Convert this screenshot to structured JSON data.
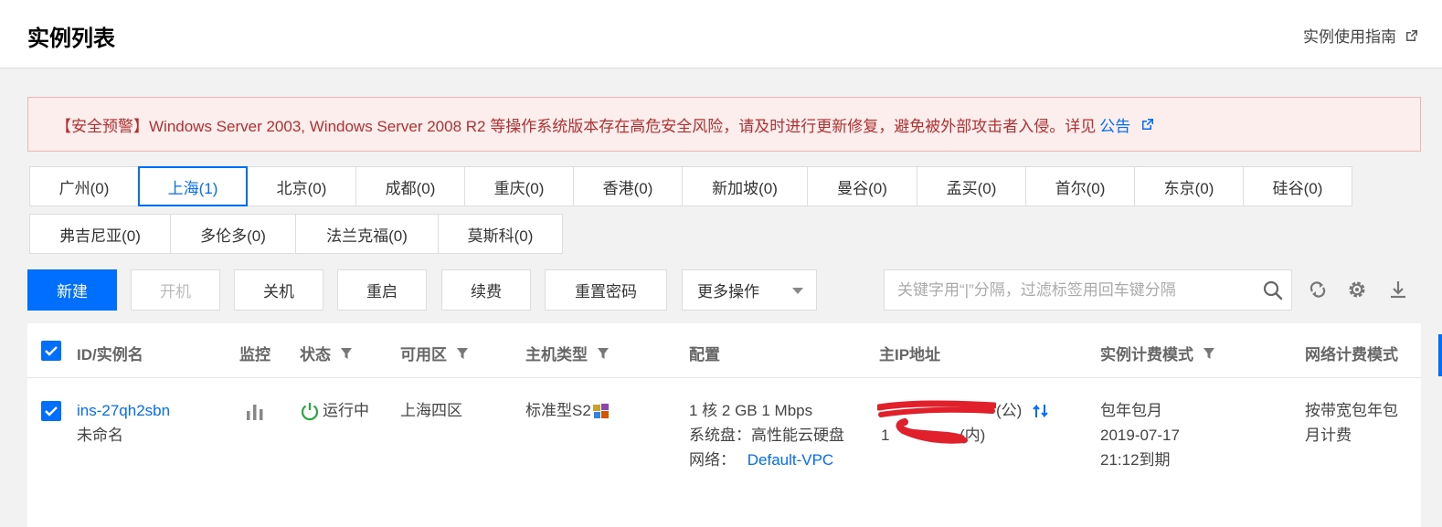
{
  "header": {
    "title": "实例列表",
    "guide_link": "实例使用指南"
  },
  "alert": {
    "text": "【安全预警】Windows Server 2003, Windows Server 2008 R2 等操作系统版本存在高危安全风险，请及时进行更新修复，避免被外部攻击者入侵。详见",
    "link": "公告"
  },
  "regions": [
    {
      "label": "广州(0)"
    },
    {
      "label": "上海(1)",
      "active": true
    },
    {
      "label": "北京(0)"
    },
    {
      "label": "成都(0)"
    },
    {
      "label": "重庆(0)"
    },
    {
      "label": "香港(0)"
    },
    {
      "label": "新加坡(0)"
    },
    {
      "label": "曼谷(0)"
    },
    {
      "label": "孟买(0)"
    },
    {
      "label": "首尔(0)"
    },
    {
      "label": "东京(0)"
    },
    {
      "label": "硅谷(0)"
    },
    {
      "label": "弗吉尼亚(0)"
    },
    {
      "label": "多伦多(0)"
    },
    {
      "label": "法兰克福(0)"
    },
    {
      "label": "莫斯科(0)"
    }
  ],
  "toolbar": {
    "new": "新建",
    "start": "开机",
    "stop": "关机",
    "restart": "重启",
    "renew": "续费",
    "reset_password": "重置密码",
    "more": "更多操作",
    "search_placeholder": "关键字用“|”分隔，过滤标签用回车键分隔"
  },
  "table": {
    "headers": {
      "id": "ID/实例名",
      "monitor": "监控",
      "status": "状态",
      "zone": "可用区",
      "type": "主机类型",
      "config": "配置",
      "ip": "主IP地址",
      "billing": "实例计费模式",
      "network_billing": "网络计费模式"
    },
    "rows": [
      {
        "id": "ins-27qh2sbn",
        "name": "未命名",
        "status": "运行中",
        "zone": "上海四区",
        "type": "标准型S2",
        "config": {
          "spec": "1 核 2 GB 1 Mbps",
          "disk": "系统盘：高性能云硬盘",
          "network_label": "网络：",
          "network_link": "Default-VPC"
        },
        "ip": {
          "public_suffix": "(公)",
          "private_prefix": "1",
          "private_suffix": "(内)"
        },
        "billing": {
          "line1": "包年包月",
          "line2": "2019-07-17",
          "line3": "21:12到期"
        },
        "network_billing": {
          "line1": "按带宽包年包",
          "line2": "月计费"
        }
      }
    ]
  },
  "colors": {
    "primary": "#006eff",
    "alert_bg": "#fdeeee",
    "alert_text": "#b43030",
    "running": "#2da641"
  }
}
